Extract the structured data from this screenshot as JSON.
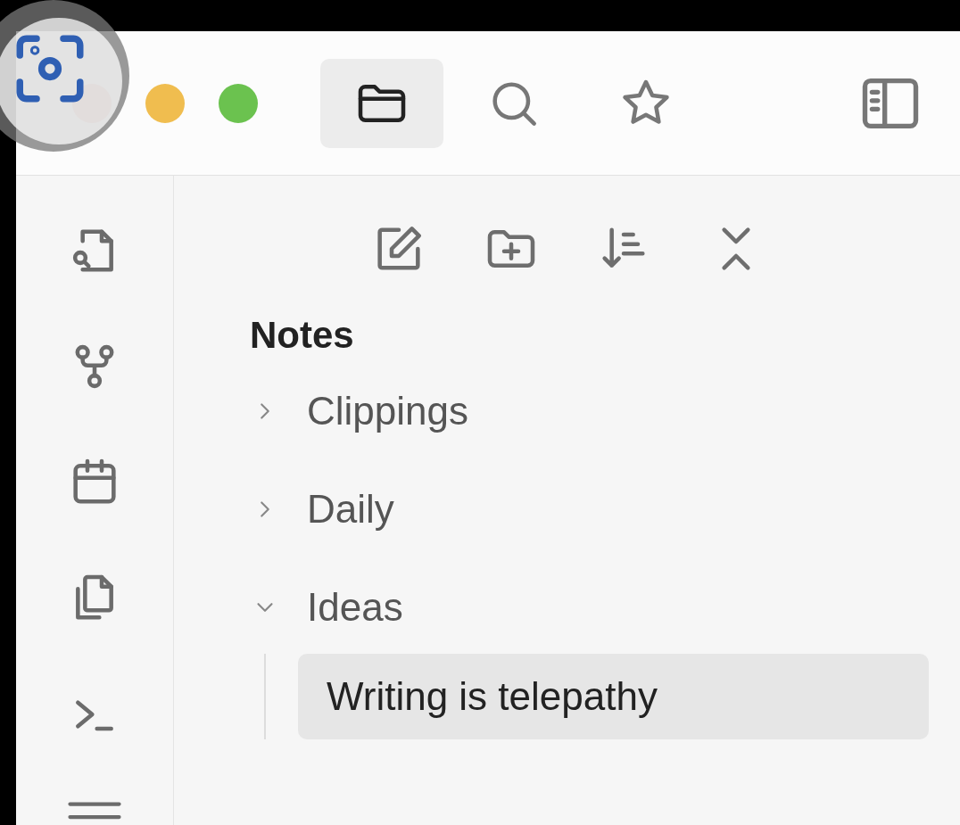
{
  "title_bar": {
    "tabs": [
      {
        "kind": "files",
        "selected": true
      },
      {
        "kind": "search",
        "selected": false
      },
      {
        "kind": "bookmarks",
        "selected": false
      }
    ]
  },
  "file_pane": {
    "vault": "Notes",
    "tree": [
      {
        "name": "Clippings",
        "expanded": false,
        "selected": false
      },
      {
        "name": "Daily",
        "expanded": false,
        "selected": false
      },
      {
        "name": "Ideas",
        "expanded": true,
        "selected": false,
        "children": [
          {
            "name": "Writing is telepathy",
            "selected": true
          }
        ]
      }
    ]
  }
}
